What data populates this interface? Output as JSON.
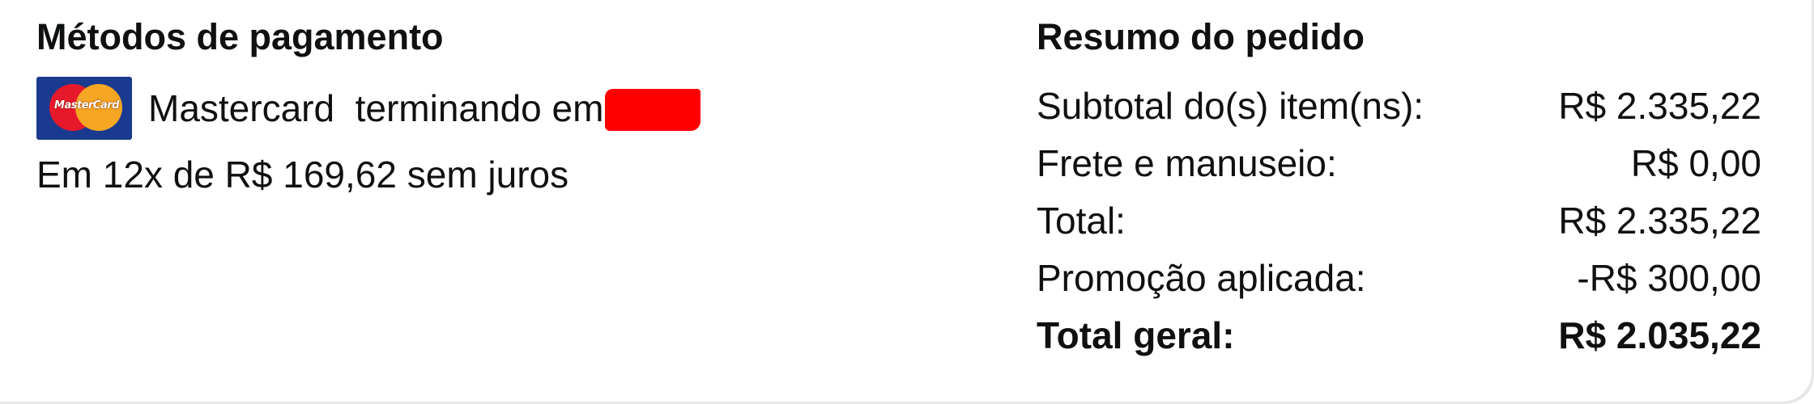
{
  "payment": {
    "title": "Métodos de pagamento",
    "card": {
      "brand_icon": "mastercard-logo",
      "brand_logo_text": "MasterCard",
      "label": "Mastercard  terminando em",
      "redaction_color": "#ff0000"
    },
    "installments": "Em 12x de R$ 169,62 sem juros"
  },
  "summary": {
    "title": "Resumo do pedido",
    "rows": [
      {
        "label": "Subtotal do(s) item(ns):",
        "value": "R$ 2.335,22"
      },
      {
        "label": "Frete e manuseio:",
        "value": "R$ 0,00"
      },
      {
        "label": "Total:",
        "value": "R$ 2.335,22"
      },
      {
        "label": "Promoção aplicada:",
        "value": "-R$ 300,00"
      }
    ],
    "grand_total": {
      "label": "Total geral:",
      "value": "R$ 2.035,22"
    }
  },
  "colors": {
    "text": "#0f1111",
    "card_background": "#1a3a8f",
    "mastercard_red": "#e8182b",
    "mastercard_yellow": "#f5a623"
  }
}
